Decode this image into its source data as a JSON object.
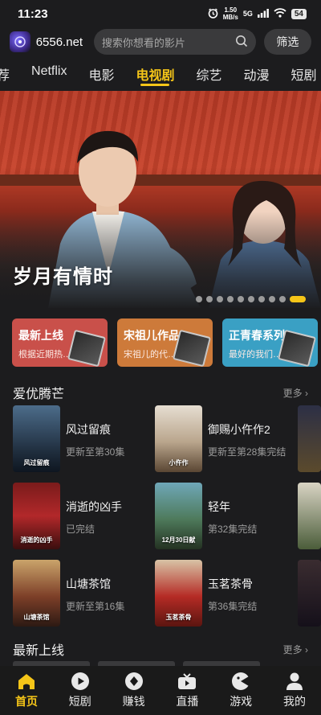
{
  "status": {
    "time": "11:23",
    "net_speed_value": "1.50",
    "net_speed_unit": "MB/s",
    "signal": "5G",
    "battery": "54"
  },
  "header": {
    "site_name": "6556.net",
    "search_placeholder": "搜索你想看的影片",
    "filter_label": "筛选"
  },
  "tabs": [
    {
      "label": "荐"
    },
    {
      "label": "Netflix"
    },
    {
      "label": "电影"
    },
    {
      "label": "电视剧",
      "active": true
    },
    {
      "label": "综艺"
    },
    {
      "label": "动漫"
    },
    {
      "label": "短剧"
    }
  ],
  "banner": {
    "title": "岁月有情时",
    "slide_count": 10,
    "active_slide": 10
  },
  "feature_cards": [
    {
      "title": "最新上线",
      "subtitle": "根据近期热…"
    },
    {
      "title": "宋祖儿作品",
      "subtitle": "宋祖儿的代…"
    },
    {
      "title": "正青春系列",
      "subtitle": "最好的我们…"
    }
  ],
  "section_iqiyi": {
    "title": "爱优腾芒",
    "more": "更多",
    "items": [
      {
        "name": "风过留痕",
        "update": "更新至第30集",
        "poster_caption": "风过留痕"
      },
      {
        "name": "御赐小仵作2",
        "update": "更新至第28集完结",
        "poster_caption": "小仵作"
      },
      {
        "name": "消逝的凶手",
        "update": "已完结",
        "poster_caption": "消逝的凶手"
      },
      {
        "name": "轻年",
        "update": "第32集完结",
        "poster_caption": "12月30日献"
      },
      {
        "name": "山塘茶馆",
        "update": "更新至第16集",
        "poster_caption": "山塘茶馆"
      },
      {
        "name": "玉茗茶骨",
        "update": "第36集完结",
        "poster_caption": "玉茗茶骨"
      }
    ]
  },
  "section_new": {
    "title": "最新上线",
    "more": "更多"
  },
  "bottom_nav": [
    {
      "label": "首页",
      "icon": "home-icon",
      "active": true
    },
    {
      "label": "短剧",
      "icon": "play-circle-icon"
    },
    {
      "label": "赚钱",
      "icon": "diamond-icon"
    },
    {
      "label": "直播",
      "icon": "tv-icon"
    },
    {
      "label": "游戏",
      "icon": "gamepad-icon"
    },
    {
      "label": "我的",
      "icon": "user-icon"
    }
  ],
  "colors": {
    "accent": "#f5c518",
    "background": "#1c1c1e",
    "card1": "#c9504a",
    "card2": "#cd7a3a",
    "card3": "#3aa0c4"
  }
}
